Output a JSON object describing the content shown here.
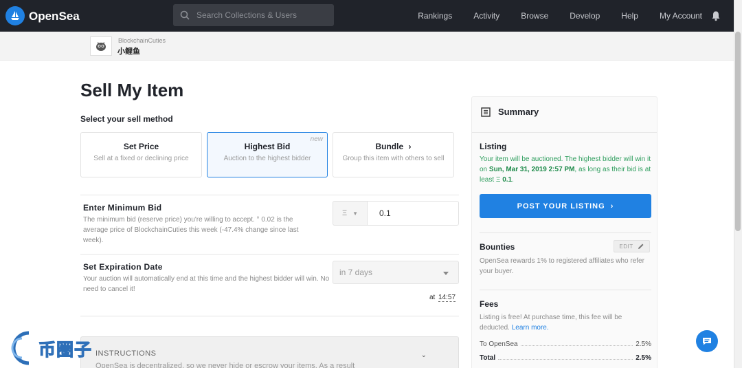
{
  "nav": {
    "brand": "OpenSea",
    "search_placeholder": "Search Collections & Users",
    "links": [
      "Rankings",
      "Activity",
      "Browse",
      "Develop",
      "Help",
      "My Account"
    ]
  },
  "breadcrumb": {
    "collection": "BlockchainCuties",
    "item": "小鲤鱼"
  },
  "page": {
    "title": "Sell My Item",
    "method_label": "Select your sell method"
  },
  "methods": [
    {
      "title": "Set Price",
      "subtitle": "Sell at a fixed or declining price"
    },
    {
      "title": "Highest Bid",
      "subtitle": "Auction to the highest bidder",
      "badge": "new"
    },
    {
      "title": "Bundle",
      "subtitle": "Group this item with others to sell"
    }
  ],
  "min_bid": {
    "title": "Enter Minimum Bid",
    "description": "The minimum bid (reserve price) you're willing to accept. ° 0.02 is the average price of BlockchainCuties this week (-47.4% change since last week).",
    "currency": "Ξ",
    "value": "0.1"
  },
  "expiration": {
    "title": "Set Expiration Date",
    "description": "Your auction will automatically end at this time and the highest bidder will win. No need to cancel it!",
    "selected": "in 7 days",
    "at_label": "at",
    "time": "14:57"
  },
  "instructions": {
    "title": "INSTRUCTIONS",
    "text": "OpenSea is decentralized, so we never hide or escrow your items. As a result"
  },
  "summary": {
    "title": "Summary",
    "listing_title": "Listing",
    "listing_pre": "Your item will be auctioned. The highest bidder will win it on ",
    "listing_date": "Sun, Mar 31, 2019 2:57 PM",
    "listing_mid": ", as long as their bid is at least ",
    "listing_currency": "Ξ",
    "listing_amount": "0.1",
    "listing_end": ".",
    "post_button": "POST YOUR LISTING",
    "bounties_title": "Bounties",
    "edit_label": "EDIT",
    "bounties_text": "OpenSea rewards 1% to registered affiliates who refer your buyer.",
    "fees_title": "Fees",
    "fees_text": "Listing is free! At purchase time, this fee will be deducted.",
    "learn_more": "Learn more.",
    "fee_rows": [
      {
        "label": "To OpenSea",
        "value": "2.5%"
      },
      {
        "label": "Total",
        "value": "2.5%"
      }
    ]
  },
  "watermark": "币圈子",
  "colors": {
    "accent": "#2081e2",
    "nav_bg": "#20232a",
    "listing_green": "#2f9e5e"
  }
}
